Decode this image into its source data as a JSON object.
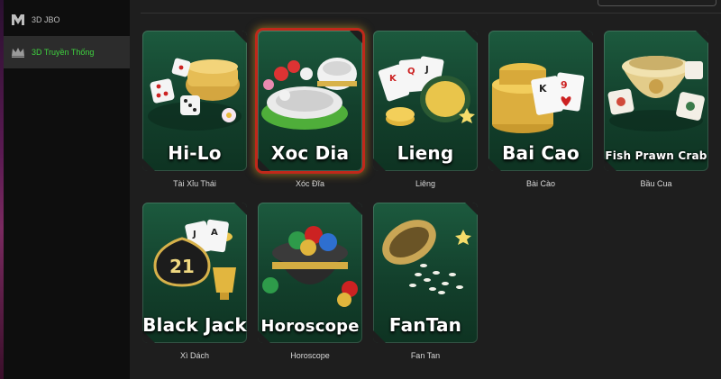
{
  "sidebar": {
    "items": [
      {
        "label": "3D JBO",
        "icon": "jbo-logo-icon",
        "active": false
      },
      {
        "label": "3D Truyền Thống",
        "icon": "crown-icon",
        "active": true
      }
    ],
    "active_color": "#3fd23f"
  },
  "games": [
    {
      "title": "Hi-Lo",
      "caption": "Tài Xỉu Thái",
      "selected": false
    },
    {
      "title": "Xoc Dia",
      "caption": "Xóc Đĩa",
      "selected": true
    },
    {
      "title": "Lieng",
      "caption": "Liêng",
      "selected": false
    },
    {
      "title": "Bai Cao",
      "caption": "Bài Cào",
      "selected": false
    },
    {
      "title": "Fish Prawn Crab",
      "caption": "Bầu Cua",
      "selected": false
    },
    {
      "title": "Black Jack",
      "caption": "Xì Dách",
      "selected": false
    },
    {
      "title": "Horoscope",
      "caption": "Horoscope",
      "selected": false
    },
    {
      "title": "FanTan",
      "caption": "Fan Tan",
      "selected": false
    }
  ],
  "colors": {
    "card_green": "#1c5a3e",
    "selection_border": "#c0281a",
    "sidebar_bg": "#0e0e0e"
  }
}
